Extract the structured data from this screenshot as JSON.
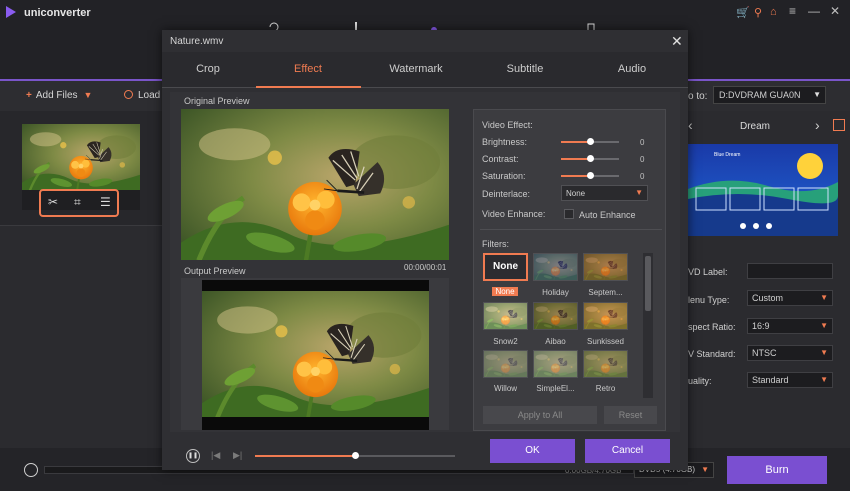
{
  "app": {
    "name": "uniconverter",
    "accent": "#f07b51",
    "purple": "#7a4fd1"
  },
  "toolbar": {
    "add_files": "Add Files",
    "load": "Load",
    "save_to_label": "o to:",
    "save_to_value": "D:DVDRAM GUA0N"
  },
  "template_panel": {
    "title": "Dream",
    "preview_banner": "Blue Dream",
    "settings": [
      {
        "label": "VD Label:",
        "value": ""
      },
      {
        "label": "lenu Type:",
        "value": "Custom"
      },
      {
        "label": "spect Ratio:",
        "value": "16:9"
      },
      {
        "label": "V Standard:",
        "value": "NTSC"
      },
      {
        "label": "uality:",
        "value": "Standard"
      }
    ]
  },
  "bottom": {
    "size_text": "0.00GB/4.70GB",
    "format_value": "DVD5 (4.70GB)",
    "burn": "Burn"
  },
  "dialog": {
    "title": "Nature.wmv",
    "tabs": [
      {
        "label": "Crop",
        "active": false
      },
      {
        "label": "Effect",
        "active": true
      },
      {
        "label": "Watermark",
        "active": false
      },
      {
        "label": "Subtitle",
        "active": false
      },
      {
        "label": "Audio",
        "active": false
      }
    ],
    "original_preview": "Original Preview",
    "output_preview": "Output Preview",
    "timecode": "00:00/00:01",
    "seek_progress": 0.5,
    "effect": {
      "heading": "Video Effect:",
      "sliders": [
        {
          "label": "Brightness:",
          "value": "0",
          "position": 0.5
        },
        {
          "label": "Contrast:",
          "value": "0",
          "position": 0.5
        },
        {
          "label": "Saturation:",
          "value": "0",
          "position": 0.5
        }
      ],
      "deinterlace_label": "Deinterlace:",
      "deinterlace_value": "None",
      "enhance_label": "Video Enhance:",
      "auto_enhance": "Auto Enhance",
      "filters_label": "Filters:",
      "filters": [
        {
          "label": "None",
          "selected": true,
          "thumb_text": "None"
        },
        {
          "label": "Holiday",
          "selected": false
        },
        {
          "label": "Septem...",
          "selected": false
        },
        {
          "label": "Snow2",
          "selected": false
        },
        {
          "label": "Aibao",
          "selected": false
        },
        {
          "label": "Sunkissed",
          "selected": false
        },
        {
          "label": "Willow",
          "selected": false
        },
        {
          "label": "SimpleEl...",
          "selected": false
        },
        {
          "label": "Retro",
          "selected": false
        }
      ],
      "apply_all": "Apply to All",
      "reset": "Reset"
    },
    "ok": "OK",
    "cancel": "Cancel"
  }
}
